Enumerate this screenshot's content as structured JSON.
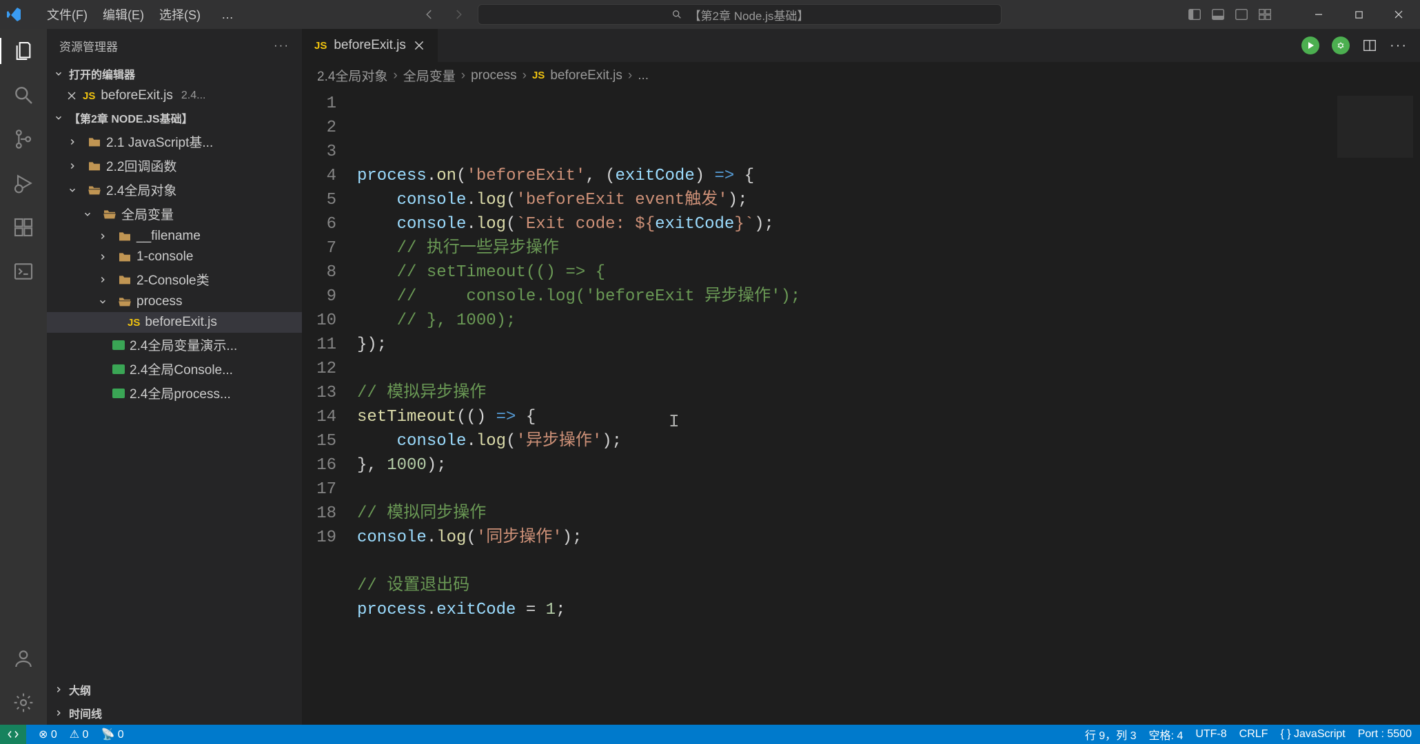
{
  "menu": {
    "file": "文件(F)",
    "edit": "编辑(E)",
    "select": "选择(S)",
    "more": "…"
  },
  "search": {
    "placeholder": "【第2章 Node.js基础】"
  },
  "sidebar": {
    "title": "资源管理器",
    "openEditors": {
      "label": "打开的编辑器"
    },
    "openEditorItem": {
      "name": "beforeExit.js",
      "path": "2.4..."
    },
    "project": "【第2章 NODE.JS基础】",
    "tree": [
      {
        "label": "2.1  JavaScript基...",
        "depth": 1,
        "type": "folder",
        "expanded": false
      },
      {
        "label": "2.2回调函数",
        "depth": 1,
        "type": "folder",
        "expanded": false
      },
      {
        "label": "2.4全局对象",
        "depth": 1,
        "type": "folder-open",
        "expanded": true
      },
      {
        "label": "全局变量",
        "depth": 2,
        "type": "folder-open",
        "expanded": true
      },
      {
        "label": "__filename",
        "depth": 3,
        "type": "folder",
        "expanded": false
      },
      {
        "label": "1-console",
        "depth": 3,
        "type": "folder",
        "expanded": false
      },
      {
        "label": "2-Console类",
        "depth": 3,
        "type": "folder",
        "expanded": false
      },
      {
        "label": "process",
        "depth": 3,
        "type": "folder-open",
        "expanded": true
      },
      {
        "label": "beforeExit.js",
        "depth": 4,
        "type": "js",
        "selected": true
      },
      {
        "label": "2.4全局变量演示...",
        "depth": 3,
        "type": "img"
      },
      {
        "label": "2.4全局Console...",
        "depth": 3,
        "type": "img"
      },
      {
        "label": "2.4全局process...",
        "depth": 3,
        "type": "img"
      }
    ],
    "outline": "大纲",
    "timeline": "时间线"
  },
  "tab": {
    "name": "beforeExit.js"
  },
  "breadcrumbs": {
    "p1": "2.4全局对象",
    "p2": "全局变量",
    "p3": "process",
    "p4": "beforeExit.js",
    "p5": "..."
  },
  "code": {
    "lines": [
      {
        "n": 1,
        "segs": [
          [
            "var",
            "process"
          ],
          [
            "punct",
            "."
          ],
          [
            "fn",
            "on"
          ],
          [
            "punct",
            "("
          ],
          [
            "str",
            "'beforeExit'"
          ],
          [
            "punct",
            ", ("
          ],
          [
            "var",
            "exitCode"
          ],
          [
            "punct",
            ") "
          ],
          [
            "op",
            "=>"
          ],
          [
            "punct",
            " {"
          ]
        ]
      },
      {
        "n": 2,
        "indent": 1,
        "segs": [
          [
            "var",
            "console"
          ],
          [
            "punct",
            "."
          ],
          [
            "fn",
            "log"
          ],
          [
            "punct",
            "("
          ],
          [
            "str",
            "'beforeExit event触发'"
          ],
          [
            "punct",
            ");"
          ]
        ]
      },
      {
        "n": 3,
        "indent": 1,
        "segs": [
          [
            "var",
            "console"
          ],
          [
            "punct",
            "."
          ],
          [
            "fn",
            "log"
          ],
          [
            "punct",
            "("
          ],
          [
            "str",
            "`Exit code: ${"
          ],
          [
            "var",
            "exitCode"
          ],
          [
            "str",
            "}`"
          ],
          [
            "punct",
            ");"
          ]
        ]
      },
      {
        "n": 4,
        "indent": 1,
        "segs": [
          [
            "cmt",
            "// 执行一些异步操作"
          ]
        ]
      },
      {
        "n": 5,
        "indent": 1,
        "segs": [
          [
            "cmt",
            "// setTimeout(() => {"
          ]
        ]
      },
      {
        "n": 6,
        "indent": 1,
        "segs": [
          [
            "cmt",
            "//     console.log('beforeExit 异步操作');"
          ]
        ]
      },
      {
        "n": 7,
        "indent": 1,
        "segs": [
          [
            "cmt",
            "// }, 1000);"
          ]
        ]
      },
      {
        "n": 8,
        "segs": [
          [
            "punct",
            "});"
          ]
        ]
      },
      {
        "n": 9,
        "segs": []
      },
      {
        "n": 10,
        "segs": [
          [
            "cmt",
            "// 模拟异步操作"
          ]
        ]
      },
      {
        "n": 11,
        "segs": [
          [
            "fn",
            "setTimeout"
          ],
          [
            "punct",
            "(() "
          ],
          [
            "op",
            "=>"
          ],
          [
            "punct",
            " {"
          ]
        ]
      },
      {
        "n": 12,
        "indent": 1,
        "segs": [
          [
            "var",
            "console"
          ],
          [
            "punct",
            "."
          ],
          [
            "fn",
            "log"
          ],
          [
            "punct",
            "("
          ],
          [
            "str",
            "'异步操作'"
          ],
          [
            "punct",
            ");"
          ]
        ]
      },
      {
        "n": 13,
        "segs": [
          [
            "punct",
            "}, "
          ],
          [
            "num",
            "1000"
          ],
          [
            "punct",
            ");"
          ]
        ]
      },
      {
        "n": 14,
        "segs": []
      },
      {
        "n": 15,
        "segs": [
          [
            "cmt",
            "// 模拟同步操作"
          ]
        ]
      },
      {
        "n": 16,
        "segs": [
          [
            "var",
            "console"
          ],
          [
            "punct",
            "."
          ],
          [
            "fn",
            "log"
          ],
          [
            "punct",
            "("
          ],
          [
            "str",
            "'同步操作'"
          ],
          [
            "punct",
            ");"
          ]
        ]
      },
      {
        "n": 17,
        "segs": []
      },
      {
        "n": 18,
        "segs": [
          [
            "cmt",
            "// 设置退出码"
          ]
        ]
      },
      {
        "n": 19,
        "segs": [
          [
            "var",
            "process"
          ],
          [
            "punct",
            "."
          ],
          [
            "var",
            "exitCode"
          ],
          [
            "punct",
            " = "
          ],
          [
            "num",
            "1"
          ],
          [
            "punct",
            ";"
          ]
        ]
      }
    ]
  },
  "status": {
    "line": "行 9，列 3",
    "spaces": "空格: 4",
    "encoding": "UTF-8",
    "eol": "CRLF",
    "lang": "{ } JavaScript",
    "port": "Port : 5500"
  }
}
